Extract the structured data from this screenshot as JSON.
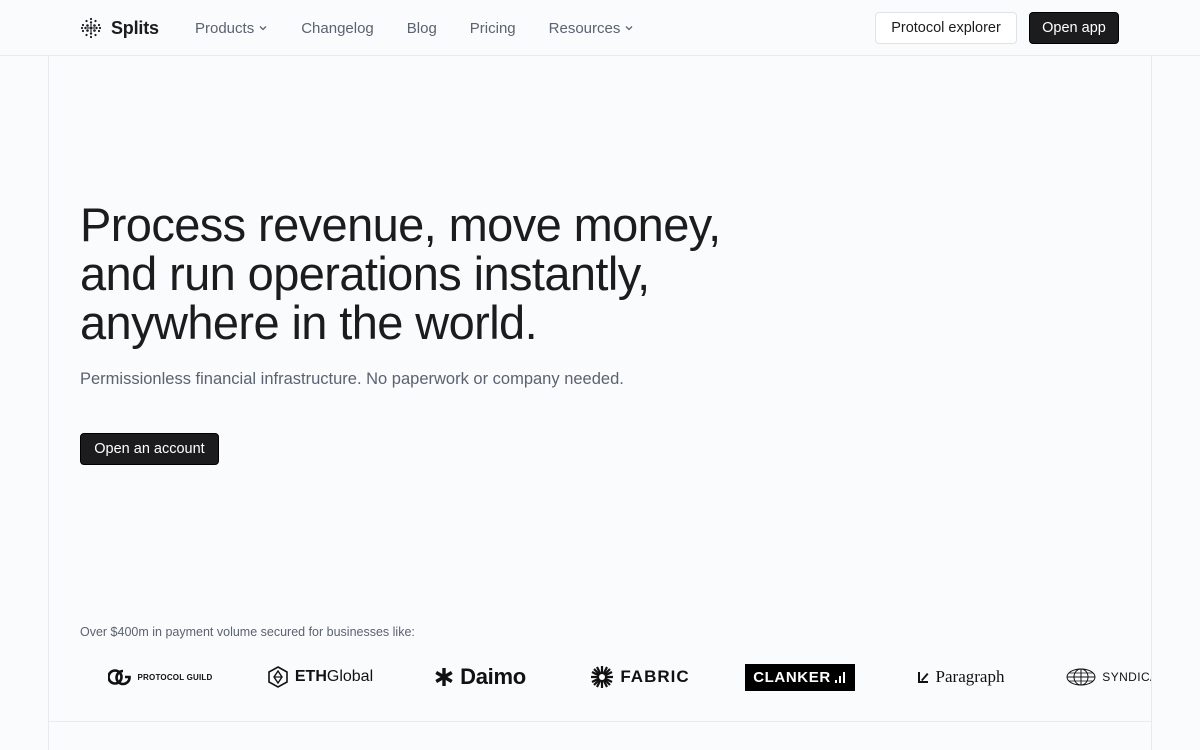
{
  "header": {
    "brand": "Splits",
    "nav": [
      {
        "label": "Products",
        "dropdown": true
      },
      {
        "label": "Changelog",
        "dropdown": false
      },
      {
        "label": "Blog",
        "dropdown": false
      },
      {
        "label": "Pricing",
        "dropdown": false
      },
      {
        "label": "Resources",
        "dropdown": true
      }
    ],
    "protocol_explorer_label": "Protocol explorer",
    "open_app_label": "Open app"
  },
  "hero": {
    "title_line1": "Process revenue, move money,",
    "title_line2": "and run operations instantly,",
    "title_line3": "anywhere in the world.",
    "subtitle": "Permissionless financial infrastructure. No paperwork or company needed.",
    "cta_label": "Open an account"
  },
  "logos": {
    "caption": "Over $400m in payment volume secured for businesses like:",
    "items": [
      {
        "name": "PROTOCOL GUILD",
        "icon": "protocol-guild-logo"
      },
      {
        "name_bold": "ETH",
        "name_rest": "Global",
        "icon": "ethglobal-logo"
      },
      {
        "name": "Daimo",
        "icon": "asterisk-icon"
      },
      {
        "name": "FABRIC",
        "icon": "fabric-star-icon"
      },
      {
        "name": "CLANKER",
        "icon": "bars-icon"
      },
      {
        "name": "Paragraph",
        "icon": "paragraph-logo"
      },
      {
        "name": "SYNDICATE",
        "icon": "globe-icon"
      }
    ]
  },
  "colors": {
    "background": "#fafbfd",
    "text_primary": "#1c1c1f",
    "text_secondary": "#5b6270",
    "border": "#e8eaee",
    "button_dark": "#1c1c1f"
  }
}
